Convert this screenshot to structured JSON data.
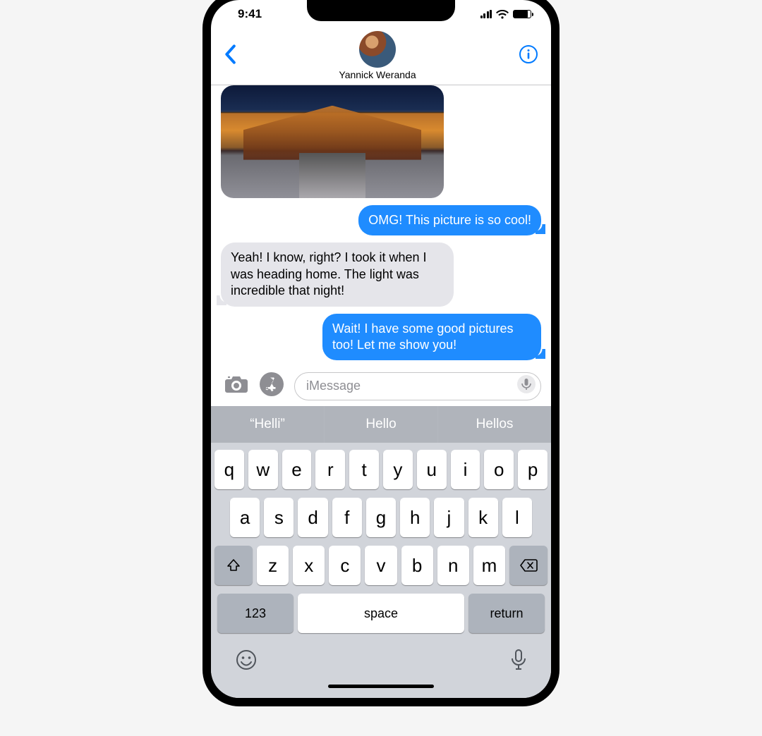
{
  "status": {
    "time": "9:41"
  },
  "header": {
    "contact_name": "Yannick Weranda"
  },
  "messages": {
    "sent1": "OMG! This picture is so cool!",
    "received1": "Yeah! I know, right? I took it when I was heading home. The light was incredible that night!",
    "sent2": "Wait! I have some good pictures too! Let me show you!"
  },
  "compose": {
    "placeholder": "iMessage",
    "value": ""
  },
  "keyboard": {
    "suggestions": [
      "“Helli”",
      "Hello",
      "Hellos"
    ],
    "row1": [
      "q",
      "w",
      "e",
      "r",
      "t",
      "y",
      "u",
      "i",
      "o",
      "p"
    ],
    "row2": [
      "a",
      "s",
      "d",
      "f",
      "g",
      "h",
      "j",
      "k",
      "l"
    ],
    "row3": [
      "z",
      "x",
      "c",
      "v",
      "b",
      "n",
      "m"
    ],
    "num_label": "123",
    "space_label": "space",
    "return_label": "return"
  }
}
